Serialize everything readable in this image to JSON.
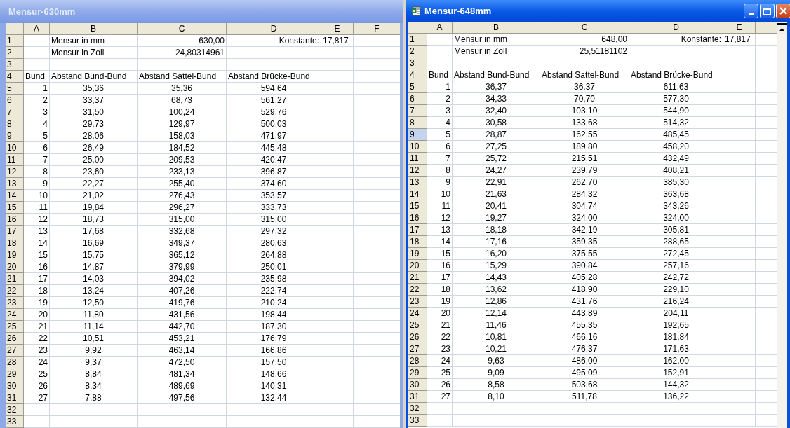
{
  "windows": [
    {
      "title": "Mensur-630mm",
      "active": false,
      "window_buttons": false,
      "scrollbar": false,
      "columns": [
        "A",
        "B",
        "C",
        "D",
        "E",
        "F"
      ],
      "rows": [
        {
          "header": "1",
          "selected": false,
          "kind": "info",
          "cells": {
            "B": "Mensur in mm",
            "C": "630,00",
            "D": "Konstante:",
            "E": "17,817"
          }
        },
        {
          "header": "2",
          "selected": false,
          "kind": "info",
          "cells": {
            "B": "Mensur in Zoll",
            "C": "24,80314961"
          }
        },
        {
          "header": "3",
          "selected": false,
          "cells": {}
        },
        {
          "header": "4",
          "selected": false,
          "kind": "labels",
          "cells": {
            "A": "Bund",
            "B": "Abstand Bund-Bund",
            "C": "Abstand Sattel-Bund",
            "D": "Abstand Brücke-Bund"
          }
        },
        {
          "header": "5",
          "selected": false,
          "kind": "data",
          "cells": {
            "A": "1",
            "B": "35,36",
            "C": "35,36",
            "D": "594,64"
          }
        },
        {
          "header": "6",
          "selected": false,
          "kind": "data",
          "cells": {
            "A": "2",
            "B": "33,37",
            "C": "68,73",
            "D": "561,27"
          }
        },
        {
          "header": "7",
          "selected": false,
          "kind": "data",
          "cells": {
            "A": "3",
            "B": "31,50",
            "C": "100,24",
            "D": "529,76"
          }
        },
        {
          "header": "8",
          "selected": false,
          "kind": "data",
          "cells": {
            "A": "4",
            "B": "29,73",
            "C": "129,97",
            "D": "500,03"
          }
        },
        {
          "header": "9",
          "selected": false,
          "kind": "data",
          "cells": {
            "A": "5",
            "B": "28,06",
            "C": "158,03",
            "D": "471,97"
          }
        },
        {
          "header": "10",
          "selected": false,
          "kind": "data",
          "cells": {
            "A": "6",
            "B": "26,49",
            "C": "184,52",
            "D": "445,48"
          }
        },
        {
          "header": "11",
          "selected": false,
          "kind": "data",
          "cells": {
            "A": "7",
            "B": "25,00",
            "C": "209,53",
            "D": "420,47"
          }
        },
        {
          "header": "12",
          "selected": false,
          "kind": "data",
          "cells": {
            "A": "8",
            "B": "23,60",
            "C": "233,13",
            "D": "396,87"
          }
        },
        {
          "header": "13",
          "selected": false,
          "kind": "data",
          "cells": {
            "A": "9",
            "B": "22,27",
            "C": "255,40",
            "D": "374,60"
          }
        },
        {
          "header": "14",
          "selected": false,
          "kind": "data",
          "cells": {
            "A": "10",
            "B": "21,02",
            "C": "276,43",
            "D": "353,57"
          }
        },
        {
          "header": "15",
          "selected": false,
          "kind": "data",
          "cells": {
            "A": "11",
            "B": "19,84",
            "C": "296,27",
            "D": "333,73"
          }
        },
        {
          "header": "16",
          "selected": false,
          "kind": "data",
          "cells": {
            "A": "12",
            "B": "18,73",
            "C": "315,00",
            "D": "315,00"
          }
        },
        {
          "header": "17",
          "selected": false,
          "kind": "data",
          "cells": {
            "A": "13",
            "B": "17,68",
            "C": "332,68",
            "D": "297,32"
          }
        },
        {
          "header": "18",
          "selected": false,
          "kind": "data",
          "cells": {
            "A": "14",
            "B": "16,69",
            "C": "349,37",
            "D": "280,63"
          }
        },
        {
          "header": "19",
          "selected": false,
          "kind": "data",
          "cells": {
            "A": "15",
            "B": "15,75",
            "C": "365,12",
            "D": "264,88"
          }
        },
        {
          "header": "20",
          "selected": false,
          "kind": "data",
          "cells": {
            "A": "16",
            "B": "14,87",
            "C": "379,99",
            "D": "250,01"
          }
        },
        {
          "header": "21",
          "selected": false,
          "kind": "data",
          "cells": {
            "A": "17",
            "B": "14,03",
            "C": "394,02",
            "D": "235,98"
          }
        },
        {
          "header": "22",
          "selected": false,
          "kind": "data",
          "cells": {
            "A": "18",
            "B": "13,24",
            "C": "407,26",
            "D": "222,74"
          }
        },
        {
          "header": "23",
          "selected": false,
          "kind": "data",
          "cells": {
            "A": "19",
            "B": "12,50",
            "C": "419,76",
            "D": "210,24"
          }
        },
        {
          "header": "24",
          "selected": false,
          "kind": "data",
          "cells": {
            "A": "20",
            "B": "11,80",
            "C": "431,56",
            "D": "198,44"
          }
        },
        {
          "header": "25",
          "selected": false,
          "kind": "data",
          "cells": {
            "A": "21",
            "B": "11,14",
            "C": "442,70",
            "D": "187,30"
          }
        },
        {
          "header": "26",
          "selected": false,
          "kind": "data",
          "cells": {
            "A": "22",
            "B": "10,51",
            "C": "453,21",
            "D": "176,79"
          }
        },
        {
          "header": "27",
          "selected": false,
          "kind": "data",
          "cells": {
            "A": "23",
            "B": "9,92",
            "C": "463,14",
            "D": "166,86"
          }
        },
        {
          "header": "28",
          "selected": false,
          "kind": "data",
          "cells": {
            "A": "24",
            "B": "9,37",
            "C": "472,50",
            "D": "157,50"
          }
        },
        {
          "header": "29",
          "selected": false,
          "kind": "data",
          "cells": {
            "A": "25",
            "B": "8,84",
            "C": "481,34",
            "D": "148,66"
          }
        },
        {
          "header": "30",
          "selected": false,
          "kind": "data",
          "cells": {
            "A": "26",
            "B": "8,34",
            "C": "489,69",
            "D": "140,31"
          }
        },
        {
          "header": "31",
          "selected": false,
          "kind": "data",
          "cells": {
            "A": "27",
            "B": "7,88",
            "C": "497,56",
            "D": "132,44"
          }
        },
        {
          "header": "32",
          "selected": false,
          "cells": {}
        },
        {
          "header": "33",
          "selected": false,
          "cells": {}
        }
      ]
    },
    {
      "title": "Mensur-648mm",
      "active": true,
      "window_buttons": true,
      "scrollbar": true,
      "columns": [
        "A",
        "B",
        "C",
        "D",
        "E"
      ],
      "rows": [
        {
          "header": "1",
          "selected": false,
          "kind": "info",
          "cells": {
            "B": "Mensur in mm",
            "C": "648,00",
            "D": "Konstante:",
            "E": "17,817"
          }
        },
        {
          "header": "2",
          "selected": false,
          "kind": "info",
          "cells": {
            "B": "Mensur in Zoll",
            "C": "25,51181102"
          }
        },
        {
          "header": "3",
          "selected": false,
          "cells": {}
        },
        {
          "header": "4",
          "selected": false,
          "kind": "labels",
          "cells": {
            "A": "Bund",
            "B": "Abstand Bund-Bund",
            "C": "Abstand Sattel-Bund",
            "D": "Abstand Brücke-Bund"
          }
        },
        {
          "header": "5",
          "selected": false,
          "kind": "data",
          "cells": {
            "A": "1",
            "B": "36,37",
            "C": "36,37",
            "D": "611,63"
          }
        },
        {
          "header": "6",
          "selected": false,
          "kind": "data",
          "cells": {
            "A": "2",
            "B": "34,33",
            "C": "70,70",
            "D": "577,30"
          }
        },
        {
          "header": "7",
          "selected": false,
          "kind": "data",
          "cells": {
            "A": "3",
            "B": "32,40",
            "C": "103,10",
            "D": "544,90"
          }
        },
        {
          "header": "8",
          "selected": false,
          "kind": "data",
          "cells": {
            "A": "4",
            "B": "30,58",
            "C": "133,68",
            "D": "514,32"
          }
        },
        {
          "header": "9",
          "selected": true,
          "kind": "data",
          "cells": {
            "A": "5",
            "B": "28,87",
            "C": "162,55",
            "D": "485,45"
          }
        },
        {
          "header": "10",
          "selected": false,
          "kind": "data",
          "cells": {
            "A": "6",
            "B": "27,25",
            "C": "189,80",
            "D": "458,20"
          }
        },
        {
          "header": "11",
          "selected": false,
          "kind": "data",
          "cells": {
            "A": "7",
            "B": "25,72",
            "C": "215,51",
            "D": "432,49"
          }
        },
        {
          "header": "12",
          "selected": false,
          "kind": "data",
          "cells": {
            "A": "8",
            "B": "24,27",
            "C": "239,79",
            "D": "408,21"
          }
        },
        {
          "header": "13",
          "selected": false,
          "kind": "data",
          "cells": {
            "A": "9",
            "B": "22,91",
            "C": "262,70",
            "D": "385,30"
          }
        },
        {
          "header": "14",
          "selected": false,
          "kind": "data",
          "cells": {
            "A": "10",
            "B": "21,63",
            "C": "284,32",
            "D": "363,68"
          }
        },
        {
          "header": "15",
          "selected": false,
          "kind": "data",
          "cells": {
            "A": "11",
            "B": "20,41",
            "C": "304,74",
            "D": "343,26"
          }
        },
        {
          "header": "16",
          "selected": false,
          "kind": "data",
          "cells": {
            "A": "12",
            "B": "19,27",
            "C": "324,00",
            "D": "324,00"
          }
        },
        {
          "header": "17",
          "selected": false,
          "kind": "data",
          "cells": {
            "A": "13",
            "B": "18,18",
            "C": "342,19",
            "D": "305,81"
          }
        },
        {
          "header": "18",
          "selected": false,
          "kind": "data",
          "cells": {
            "A": "14",
            "B": "17,16",
            "C": "359,35",
            "D": "288,65"
          }
        },
        {
          "header": "19",
          "selected": false,
          "kind": "data",
          "cells": {
            "A": "15",
            "B": "16,20",
            "C": "375,55",
            "D": "272,45"
          }
        },
        {
          "header": "20",
          "selected": false,
          "kind": "data",
          "cells": {
            "A": "16",
            "B": "15,29",
            "C": "390,84",
            "D": "257,16"
          }
        },
        {
          "header": "21",
          "selected": false,
          "kind": "data",
          "cells": {
            "A": "17",
            "B": "14,43",
            "C": "405,28",
            "D": "242,72"
          }
        },
        {
          "header": "22",
          "selected": false,
          "kind": "data",
          "cells": {
            "A": "18",
            "B": "13,62",
            "C": "418,90",
            "D": "229,10"
          }
        },
        {
          "header": "23",
          "selected": false,
          "kind": "data",
          "cells": {
            "A": "19",
            "B": "12,86",
            "C": "431,76",
            "D": "216,24"
          }
        },
        {
          "header": "24",
          "selected": false,
          "kind": "data",
          "cells": {
            "A": "20",
            "B": "12,14",
            "C": "443,89",
            "D": "204,11"
          }
        },
        {
          "header": "25",
          "selected": false,
          "kind": "data",
          "cells": {
            "A": "21",
            "B": "11,46",
            "C": "455,35",
            "D": "192,65"
          }
        },
        {
          "header": "26",
          "selected": false,
          "kind": "data",
          "cells": {
            "A": "22",
            "B": "10,81",
            "C": "466,16",
            "D": "181,84"
          }
        },
        {
          "header": "27",
          "selected": false,
          "kind": "data",
          "cells": {
            "A": "23",
            "B": "10,21",
            "C": "476,37",
            "D": "171,63"
          }
        },
        {
          "header": "28",
          "selected": false,
          "kind": "data",
          "cells": {
            "A": "24",
            "B": "9,63",
            "C": "486,00",
            "D": "162,00"
          }
        },
        {
          "header": "29",
          "selected": false,
          "kind": "data",
          "cells": {
            "A": "25",
            "B": "9,09",
            "C": "495,09",
            "D": "152,91"
          }
        },
        {
          "header": "30",
          "selected": false,
          "kind": "data",
          "cells": {
            "A": "26",
            "B": "8,58",
            "C": "503,68",
            "D": "144,32"
          }
        },
        {
          "header": "31",
          "selected": false,
          "kind": "data",
          "cells": {
            "A": "27",
            "B": "8,10",
            "C": "511,78",
            "D": "136,22"
          }
        },
        {
          "header": "32",
          "selected": false,
          "cells": {}
        },
        {
          "header": "33",
          "selected": false,
          "cells": {}
        }
      ]
    }
  ]
}
